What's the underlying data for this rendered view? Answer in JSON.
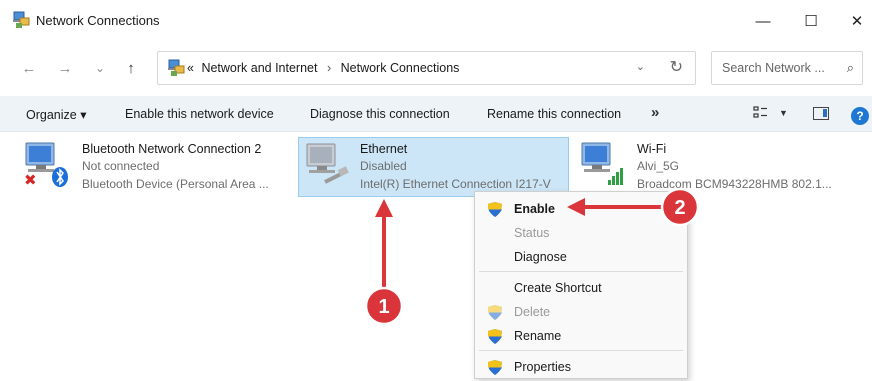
{
  "window": {
    "title": "Network Connections",
    "minimize": "—",
    "maximize": "☐",
    "close": "✕"
  },
  "nav": {
    "back": "←",
    "forward": "→",
    "recent": "⌄",
    "up": "↑",
    "breadcrumb_prefix": "«",
    "breadcrumb": [
      "Network and Internet",
      "Network Connections"
    ],
    "breadcrumb_sep": "›",
    "dropdown": "⌄",
    "refresh": "↻",
    "search_placeholder": "Search Network ...",
    "search_icon": "⌕"
  },
  "toolbar": {
    "organize": "Organize ▾",
    "enable": "Enable this network device",
    "diagnose": "Diagnose this connection",
    "rename": "Rename this connection",
    "more": "»",
    "view_dropdown": "▼",
    "help": "?"
  },
  "items": [
    {
      "name": "Bluetooth Network Connection 2",
      "status": "Not connected",
      "device": "Bluetooth Device (Personal Area ...",
      "icon": "network-adapter-bluetooth-icon"
    },
    {
      "name": "Ethernet",
      "status": "Disabled",
      "device": "Intel(R) Ethernet Connection I217-V",
      "icon": "network-adapter-ethernet-icon"
    },
    {
      "name": "Wi-Fi",
      "status": "Alvi_5G",
      "device": "Broadcom BCM943228HMB 802.1...",
      "icon": "network-adapter-wifi-icon"
    }
  ],
  "context_menu": {
    "enable": "Enable",
    "status": "Status",
    "diagnose": "Diagnose",
    "create_shortcut": "Create Shortcut",
    "delete": "Delete",
    "rename": "Rename",
    "properties": "Properties"
  },
  "annotations": {
    "badge1": "1",
    "badge2": "2",
    "color": "#d9353a"
  }
}
